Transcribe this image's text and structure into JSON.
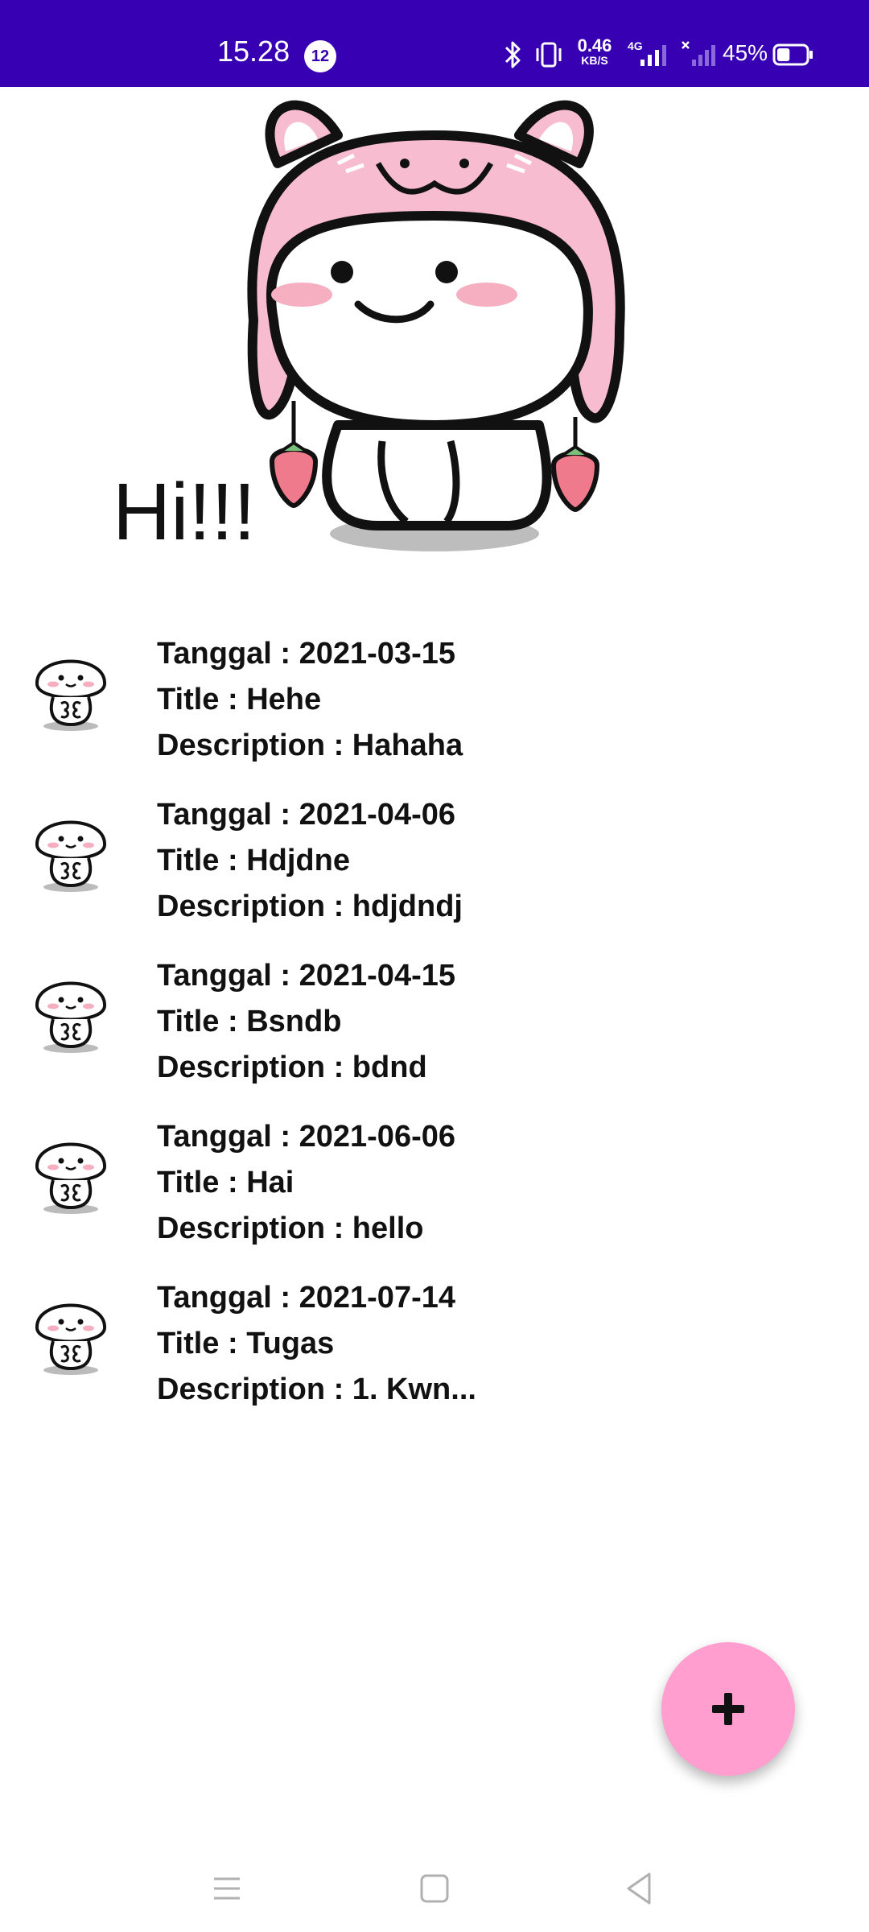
{
  "status_bar": {
    "time": "15.28",
    "notification_count": "12",
    "net_speed_value": "0.46",
    "net_speed_unit": "KB/S",
    "network_type": "4G",
    "battery_percent": "45%",
    "battery_level": 0.45,
    "icons": [
      "bluetooth-icon",
      "vibrate-icon",
      "signal-icon",
      "no-signal-icon",
      "battery-icon"
    ]
  },
  "hero": {
    "greeting": "Hi!!!",
    "image": "pink-bunny-hood-sticker"
  },
  "notes": [
    {
      "date_line": "Tanggal : 2021-03-15",
      "title_line": "Title : Hehe",
      "desc_line": "Description : Hahaha"
    },
    {
      "date_line": "Tanggal : 2021-04-06",
      "title_line": "Title : Hdjdne",
      "desc_line": "Description : hdjdndj"
    },
    {
      "date_line": "Tanggal : 2021-04-15",
      "title_line": "Title : Bsndb",
      "desc_line": "Description : bdnd"
    },
    {
      "date_line": "Tanggal : 2021-06-06",
      "title_line": "Title : Hai",
      "desc_line": "Description : hello"
    },
    {
      "date_line": "Tanggal : 2021-07-14",
      "title_line": "Title : Tugas",
      "desc_line": "Description : 1. Kwn..."
    }
  ],
  "fab": {
    "icon": "plus-icon",
    "color": "#FF9ECF"
  },
  "nav_bar": {
    "icons": [
      "menu-icon",
      "home-icon",
      "back-icon"
    ]
  },
  "colors": {
    "status_bar": "#3700B3",
    "background": "#FFFFFF",
    "fab": "#FF9ECF",
    "text": "#111111"
  }
}
